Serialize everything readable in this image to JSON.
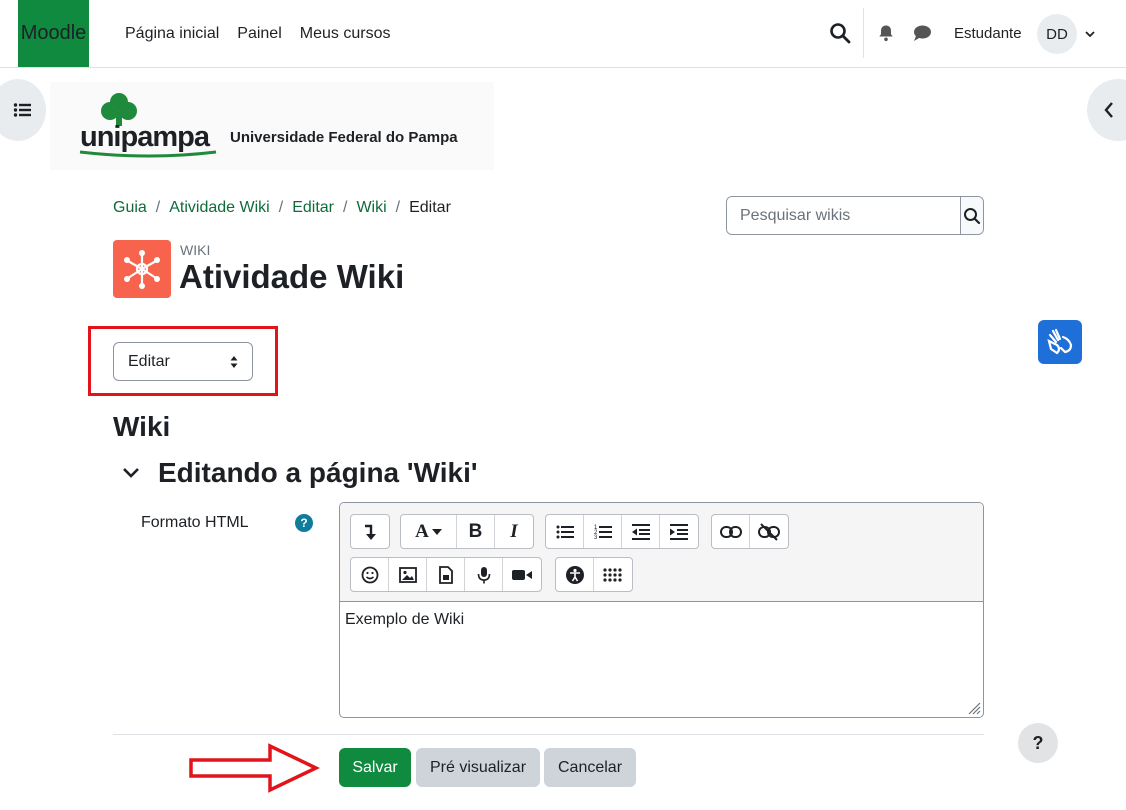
{
  "navbar": {
    "brand": "Moodle",
    "links": [
      "Página inicial",
      "Painel",
      "Meus cursos"
    ],
    "user_name": "Estudante",
    "avatar_initials": "DD"
  },
  "logo": {
    "name": "unipampa",
    "subtitle": "Universidade Federal do Pampa"
  },
  "breadcrumb": {
    "items": [
      "Guia",
      "Atividade Wiki",
      "Editar",
      "Wiki"
    ],
    "current": "Editar"
  },
  "search": {
    "placeholder": "Pesquisar wikis"
  },
  "activity": {
    "type": "WIKI",
    "title": "Atividade Wiki",
    "icon_color": "#f7634d"
  },
  "mode_select": {
    "selected": "Editar"
  },
  "page": {
    "heading": "Wiki",
    "section_heading": "Editando a página 'Wiki'"
  },
  "form": {
    "format_label": "Formato HTML",
    "editor_content": "Exemplo de Wiki",
    "toolbar_icons": [
      "collapse-icon",
      "font-color-icon",
      "bold-icon",
      "italic-icon",
      "unordered-list-icon",
      "ordered-list-icon",
      "outdent-icon",
      "indent-icon",
      "link-icon",
      "unlink-icon",
      "emoji-icon",
      "image-icon",
      "media-file-icon",
      "record-audio-icon",
      "record-video-icon",
      "accessibility-checker-icon",
      "equation-grid-icon"
    ]
  },
  "buttons": {
    "save": "Salvar",
    "preview": "Pré visualizar",
    "cancel": "Cancelar"
  },
  "colors": {
    "brand_green": "#0f8a3f",
    "link_green": "#0f6b3a",
    "highlight_red": "#e1131b",
    "accessibility_blue": "#1f6fd8"
  }
}
